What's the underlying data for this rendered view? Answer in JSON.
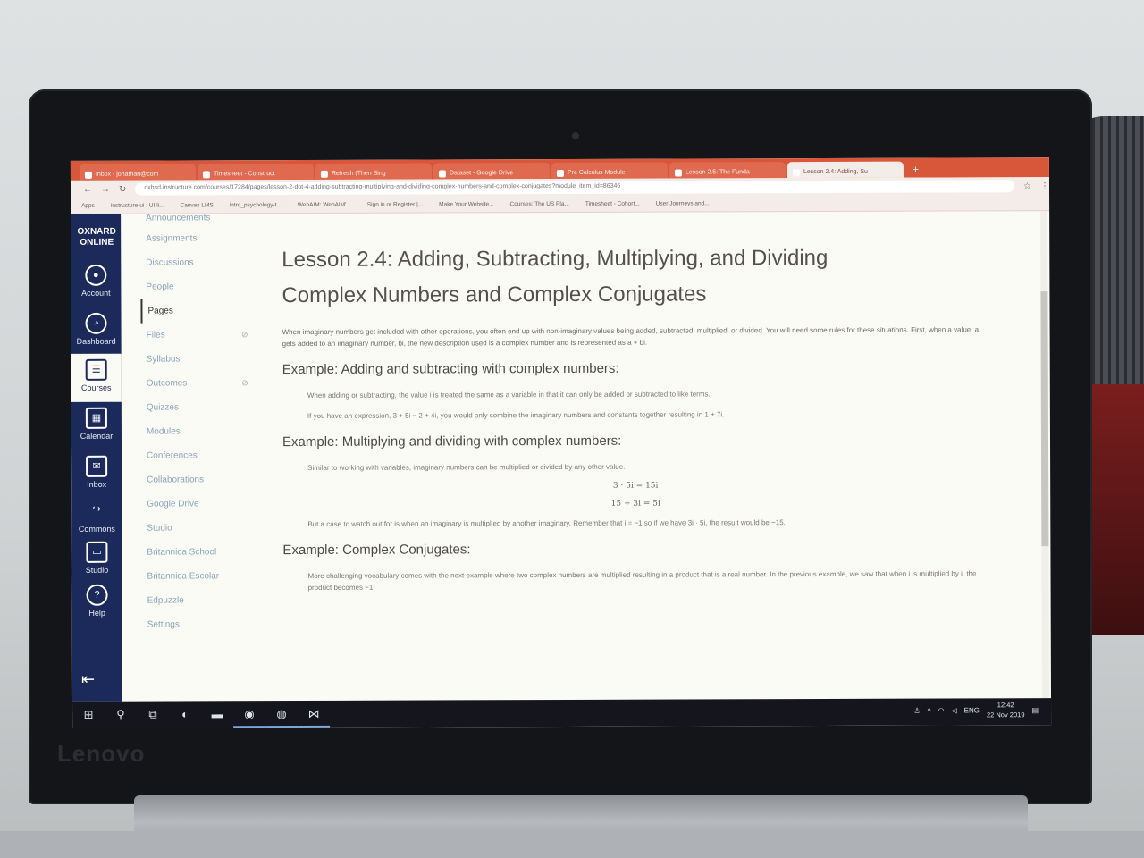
{
  "browser": {
    "tabs": [
      {
        "label": "Inbox - jonathan@com",
        "active": false
      },
      {
        "label": "Timesheet - Construct",
        "active": false
      },
      {
        "label": "Refresh (Then Sing",
        "active": false
      },
      {
        "label": "Dataset - Google Drive",
        "active": false
      },
      {
        "label": "Pre Calculus Module",
        "active": false
      },
      {
        "label": "Lesson 2.5: The Funda",
        "active": false
      },
      {
        "label": "Lesson 2.4: Adding, Su",
        "active": true
      }
    ],
    "new_tab": "+",
    "url": "oxhsd.instructure.com/courses/17284/pages/lesson-2-dot-4-adding-subtracting-multiplying-and-dividing-complex-numbers-and-complex-conjugates?module_item_id=86346",
    "bookmarks": [
      "Apps",
      "instructure-ui : UI li...",
      "Canvas LMS",
      "intro_psychology-t...",
      "WebAIM: WebAIM'...",
      "Sign in or Register |...",
      "Make Your Website...",
      "Courses: The US Pla...",
      "Timesheet - Cohort...",
      "User Journeys and..."
    ]
  },
  "global_nav": {
    "logo_line1": "OXNARD",
    "logo_line2": "ONLINE",
    "items": [
      {
        "label": "Account",
        "icon": "account-icon"
      },
      {
        "label": "Dashboard",
        "icon": "dashboard-icon"
      },
      {
        "label": "Courses",
        "icon": "courses-icon"
      },
      {
        "label": "Calendar",
        "icon": "calendar-icon"
      },
      {
        "label": "Inbox",
        "icon": "inbox-icon"
      },
      {
        "label": "Commons",
        "icon": "commons-icon"
      },
      {
        "label": "Studio",
        "icon": "studio-icon"
      },
      {
        "label": "Help",
        "icon": "help-icon"
      }
    ],
    "active": "Courses"
  },
  "course_nav": {
    "items": [
      "Announcements",
      "Assignments",
      "Discussions",
      "People",
      "Pages",
      "Files",
      "Syllabus",
      "Outcomes",
      "Quizzes",
      "Modules",
      "Conferences",
      "Collaborations",
      "Google Drive",
      "Studio",
      "Britannica School",
      "Britannica Escolar",
      "Edpuzzle",
      "Settings"
    ],
    "active": "Pages"
  },
  "page": {
    "title_line1": "Lesson 2.4: Adding, Subtracting, Multiplying, and Dividing",
    "title_line2": "Complex Numbers and Complex Conjugates",
    "intro": "When imaginary numbers get included with other operations, you often end up with non-imaginary values being added, subtracted, multiplied, or divided. You will need some rules for these situations. First, when a value, a, gets added to an imaginary number, bi, the new description used is a complex number and is represented as a + bi.",
    "sections": [
      {
        "heading": "Example: Adding and subtracting with complex numbers:",
        "paragraphs": [
          "When adding or subtracting, the value i is treated the same as a variable in that it can only be added or subtracted to like terms.",
          "If you have an expression, 3 + 5i − 2 + 4i, you would only combine the imaginary numbers and constants together resulting in 1 + 7i."
        ]
      },
      {
        "heading": "Example: Multiplying and dividing with complex numbers:",
        "paragraphs": [
          "Similar to working with variables, imaginary numbers can be multiplied or divided by any other value."
        ],
        "math": [
          "3 · 5i = 15i",
          "15 ÷ 3i = 5i"
        ],
        "after": "But a case to watch out for is when an imaginary is multiplied by another imaginary. Remember that i = −1 so if we have 3i · 5i, the result would be −15."
      },
      {
        "heading": "Example: Complex Conjugates:",
        "paragraphs": [
          "More challenging vocabulary comes with the next example where two complex numbers are multiplied resulting in a product that is a real number. In the previous example, we saw that when i is multiplied by i, the product becomes −1."
        ]
      }
    ]
  },
  "taskbar": {
    "language": "ENG",
    "time": "12:42",
    "date": "22 Nov 2019"
  },
  "laptop_brand": "Lenovo"
}
